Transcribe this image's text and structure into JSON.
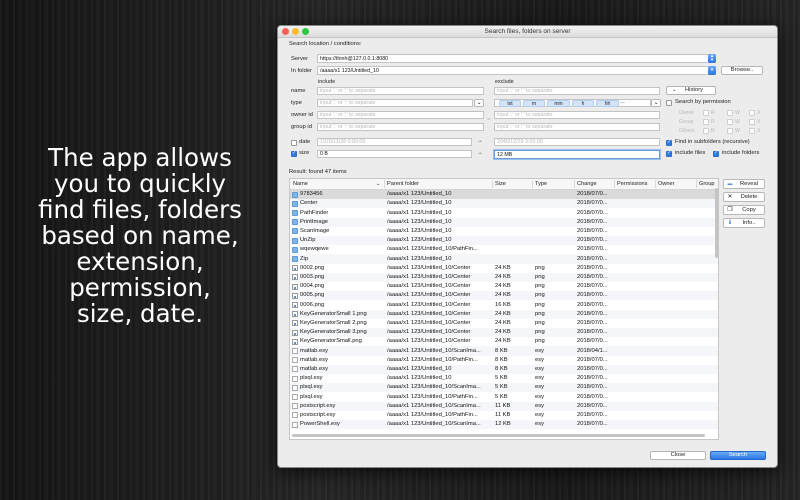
{
  "promo": {
    "lines": [
      "The app allows",
      "you to quickly",
      "find files, folders",
      "based on name,",
      "extension,",
      "permission,",
      "size, date."
    ]
  },
  "window": {
    "title": "Search files, folders on server",
    "controls": {
      "close_color": "#fc5f57",
      "minimize_color": "#fdbc2e",
      "zoom_color": "#2ac940"
    }
  },
  "form": {
    "section_label": "Search location / conditions:",
    "server_label": "Server",
    "server_value": "https://thinh@127.0.0.1:8080",
    "folder_label": "In folder",
    "folder_value": "/aaaa/x1 123/Untitled_10",
    "browse_label": "Browse..",
    "include_header": "include",
    "exclude_header": "exclude",
    "name_label": "name",
    "type_label": "type",
    "owner_label": "owner id",
    "group_label": "group id",
    "separator_placeholder": "input ',' or ';' to separate",
    "equals": "=",
    "type_tags": [
      "txt",
      "m",
      "mm",
      "h",
      "hh"
    ],
    "type_tags_more": "...",
    "history_label": "History",
    "date_label": "date",
    "date_from_placeholder": "1970/11/28 0:00:00",
    "date_to_placeholder": "2040/12/29 0:00:00",
    "size_label": "size",
    "size_from_value": "0 B",
    "size_to_value": "12 MB",
    "arrow": "→",
    "search_by_permission": "Search by permission",
    "perm_rows": [
      {
        "name": "Owner",
        "r": "R",
        "w": "W",
        "x": "X"
      },
      {
        "name": "Group",
        "r": "R",
        "w": "W",
        "x": "X"
      },
      {
        "name": "Others",
        "r": "R",
        "w": "W",
        "x": "X"
      }
    ],
    "find_in_subfolders": "Find in subfolders (recursive)",
    "include_files": "include files",
    "include_folders": "include folders"
  },
  "results": {
    "summary": "Result: found 47 items",
    "columns": [
      "Name",
      "Parent folder",
      "Size",
      "Type",
      "Change",
      "Permissions",
      "Owner",
      "Group"
    ],
    "rows": [
      {
        "icon": "folder",
        "name": "9783456",
        "parent": "/aaaa/x1 123/Untitled_10",
        "size": "",
        "type": "",
        "change": "2018/07/0..."
      },
      {
        "icon": "folder",
        "name": "Center",
        "parent": "/aaaa/x1 123/Untitled_10",
        "size": "",
        "type": "",
        "change": "2018/07/0..."
      },
      {
        "icon": "folder",
        "name": "PathFinder",
        "parent": "/aaaa/x1 123/Untitled_10",
        "size": "",
        "type": "",
        "change": "2018/07/0..."
      },
      {
        "icon": "folder",
        "name": "PrintImage",
        "parent": "/aaaa/x1 123/Untitled_10",
        "size": "",
        "type": "",
        "change": "2018/07/0..."
      },
      {
        "icon": "folder",
        "name": "ScanImage",
        "parent": "/aaaa/x1 123/Untitled_10",
        "size": "",
        "type": "",
        "change": "2018/07/0..."
      },
      {
        "icon": "folder",
        "name": "UnZip",
        "parent": "/aaaa/x1 123/Untitled_10",
        "size": "",
        "type": "",
        "change": "2018/07/0..."
      },
      {
        "icon": "folder",
        "name": "wqewqewe",
        "parent": "/aaaa/x1 123/Untitled_10/PathFin...",
        "size": "",
        "type": "",
        "change": "2018/07/0..."
      },
      {
        "icon": "folder",
        "name": "Zip",
        "parent": "/aaaa/x1 123/Untitled_10",
        "size": "",
        "type": "",
        "change": "2018/07/0..."
      },
      {
        "icon": "image",
        "name": "0002.png",
        "parent": "/aaaa/x1 123/Untitled_10/Center",
        "size": "24 KB",
        "type": "png",
        "change": "2018/07/0..."
      },
      {
        "icon": "image",
        "name": "0003.png",
        "parent": "/aaaa/x1 123/Untitled_10/Center",
        "size": "24 KB",
        "type": "png",
        "change": "2018/07/0..."
      },
      {
        "icon": "image",
        "name": "0004.png",
        "parent": "/aaaa/x1 123/Untitled_10/Center",
        "size": "24 KB",
        "type": "png",
        "change": "2018/07/0..."
      },
      {
        "icon": "image",
        "name": "0005.png",
        "parent": "/aaaa/x1 123/Untitled_10/Center",
        "size": "24 KB",
        "type": "png",
        "change": "2018/07/0..."
      },
      {
        "icon": "image",
        "name": "0006.png",
        "parent": "/aaaa/x1 123/Untitled_10/Center",
        "size": "16 KB",
        "type": "png",
        "change": "2018/07/0..."
      },
      {
        "icon": "image",
        "name": "KeyGeneratorSmall 1.png",
        "parent": "/aaaa/x1 123/Untitled_10/Center",
        "size": "24 KB",
        "type": "png",
        "change": "2018/07/0..."
      },
      {
        "icon": "image",
        "name": "KeyGeneratorSmall 2.png",
        "parent": "/aaaa/x1 123/Untitled_10/Center",
        "size": "24 KB",
        "type": "png",
        "change": "2018/07/0..."
      },
      {
        "icon": "image",
        "name": "KeyGeneratorSmall 3.png",
        "parent": "/aaaa/x1 123/Untitled_10/Center",
        "size": "24 KB",
        "type": "png",
        "change": "2018/07/0..."
      },
      {
        "icon": "image",
        "name": "KeyGeneratorSmall.png",
        "parent": "/aaaa/x1 123/Untitled_10/Center",
        "size": "24 KB",
        "type": "png",
        "change": "2018/07/0..."
      },
      {
        "icon": "file",
        "name": "matlab.esy",
        "parent": "/aaaa/x1 123/Untitled_10/ScanIma...",
        "size": "8 KB",
        "type": "esy",
        "change": "2018/04/1..."
      },
      {
        "icon": "file",
        "name": "matlab.esy",
        "parent": "/aaaa/x1 123/Untitled_10/PathFin...",
        "size": "8 KB",
        "type": "esy",
        "change": "2018/07/0..."
      },
      {
        "icon": "file",
        "name": "matlab.esy",
        "parent": "/aaaa/x1 123/Untitled_10",
        "size": "8 KB",
        "type": "esy",
        "change": "2018/07/0..."
      },
      {
        "icon": "file",
        "name": "plsql.esy",
        "parent": "/aaaa/x1 123/Untitled_10",
        "size": "5 KB",
        "type": "esy",
        "change": "2018/07/0..."
      },
      {
        "icon": "file",
        "name": "plsql.esy",
        "parent": "/aaaa/x1 123/Untitled_10/ScanIma...",
        "size": "5 KB",
        "type": "esy",
        "change": "2018/07/0..."
      },
      {
        "icon": "file",
        "name": "plsql.esy",
        "parent": "/aaaa/x1 123/Untitled_10/PathFin...",
        "size": "5 KB",
        "type": "esy",
        "change": "2018/07/0..."
      },
      {
        "icon": "file",
        "name": "postscript.esy",
        "parent": "/aaaa/x1 123/Untitled_10/ScanIma...",
        "size": "11 KB",
        "type": "esy",
        "change": "2018/07/0..."
      },
      {
        "icon": "file",
        "name": "postscript.esy",
        "parent": "/aaaa/x1 123/Untitled_10/PathFin...",
        "size": "11 KB",
        "type": "esy",
        "change": "2018/07/0..."
      },
      {
        "icon": "file",
        "name": "PowerShell.esy",
        "parent": "/aaaa/x1 123/Untitled_10/ScanIma...",
        "size": "12 KB",
        "type": "esy",
        "change": "2018/07/0..."
      }
    ],
    "selected_row": 0
  },
  "side_actions": [
    {
      "icon": "reveal-icon",
      "glyph": "▬",
      "label": "Reveal"
    },
    {
      "icon": "delete-icon",
      "glyph": "✕",
      "label": "Delete"
    },
    {
      "icon": "copy-icon",
      "glyph": "❐",
      "label": "Copy"
    },
    {
      "icon": "info-icon",
      "glyph": "ℹ",
      "label": "Info.."
    }
  ],
  "footer": {
    "close_label": "Close",
    "search_label": "Search"
  }
}
